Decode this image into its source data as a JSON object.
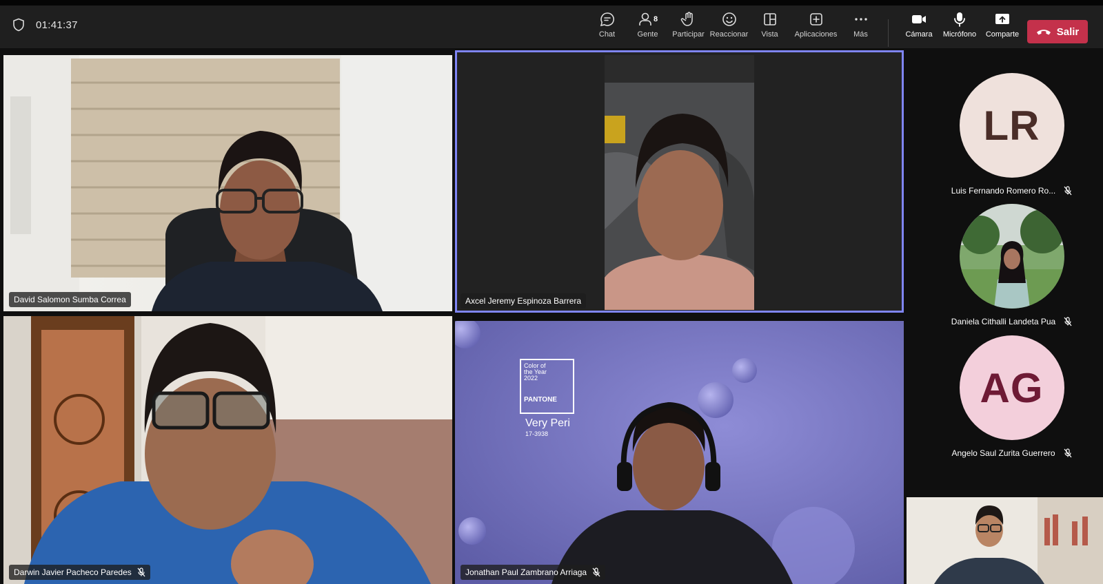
{
  "meeting": {
    "timer": "01:41:37"
  },
  "toolbar": {
    "chat": "Chat",
    "people": "Gente",
    "people_count": "8",
    "raise": "Participar",
    "react": "Reaccionar",
    "view": "Vista",
    "apps": "Aplicaciones",
    "more": "Más",
    "camera": "Cámara",
    "mic": "Micrófono",
    "share": "Comparte",
    "leave": "Salir"
  },
  "tiles": [
    {
      "name": "David Salomon Sumba Correa"
    },
    {
      "name": "Axcel Jeremy Espinoza Barrera"
    },
    {
      "name": "Darwin Javier Pacheco Paredes"
    },
    {
      "name": "Jonathan Paul Zambrano Arriaga"
    }
  ],
  "pantone": {
    "card": [
      "Color of",
      "the Year",
      "2022",
      "PANTONE"
    ],
    "name": "Very Peri",
    "code": "17-3938"
  },
  "roster": [
    {
      "initials": "LR",
      "name": "Luis Fernando Romero Ro...",
      "avatar_bg": "#efe1dc",
      "initials_color": "#4a2d28"
    },
    {
      "initials": "",
      "name": "Daniela Cithalli Landeta Pua"
    },
    {
      "initials": "AG",
      "name": "Angelo Saul Zurita Guerrero",
      "avatar_bg": "#f3cfdb",
      "initials_color": "#6e1a35"
    }
  ],
  "colors": {
    "active_speaker": "#7f85f5",
    "leave_button": "#c4314b",
    "toolbar_bg": "#1f1f1f"
  }
}
